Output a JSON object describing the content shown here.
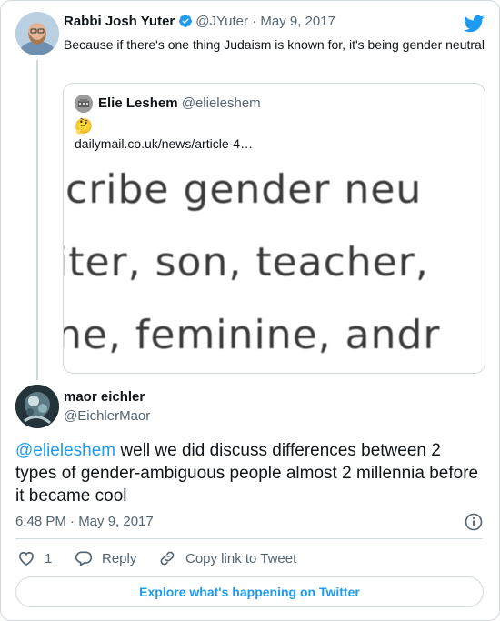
{
  "parent_tweet": {
    "author_name": "Rabbi Josh Yuter",
    "handle": "@JYuter",
    "date": "May 9, 2017",
    "separator": "·",
    "text": "Because if there's one thing Judaism is known for, it's being gender neutral"
  },
  "quoted_tweet": {
    "author_name": "Elie Leshem",
    "handle": "@elieleshem",
    "emoji": "🤔",
    "link": "dailymail.co.uk/news/article-4…",
    "image_lines": [
      "cribe gender neu",
      "iter, son, teacher,",
      "ne, feminine, andr"
    ]
  },
  "reply_tweet": {
    "author_name": "maor eichler",
    "handle": "@EichlerMaor",
    "mention": "@elieleshem",
    "text": " well we did discuss differences between 2 types of gender-ambiguous people almost 2 millennia before it became cool",
    "timestamp": "6:48 PM · May 9, 2017"
  },
  "actions": {
    "like_count": "1",
    "reply_label": "Reply",
    "copy_link_label": "Copy link to Tweet"
  },
  "footer": {
    "explore_label": "Explore what's happening on Twitter"
  },
  "colors": {
    "accent": "#1d9bf0",
    "secondary_text": "#536471",
    "border": "#cfd9de"
  },
  "icons": [
    "verified-badge-icon",
    "twitter-bird-icon",
    "info-icon",
    "heart-icon",
    "reply-bubble-icon",
    "link-icon"
  ]
}
